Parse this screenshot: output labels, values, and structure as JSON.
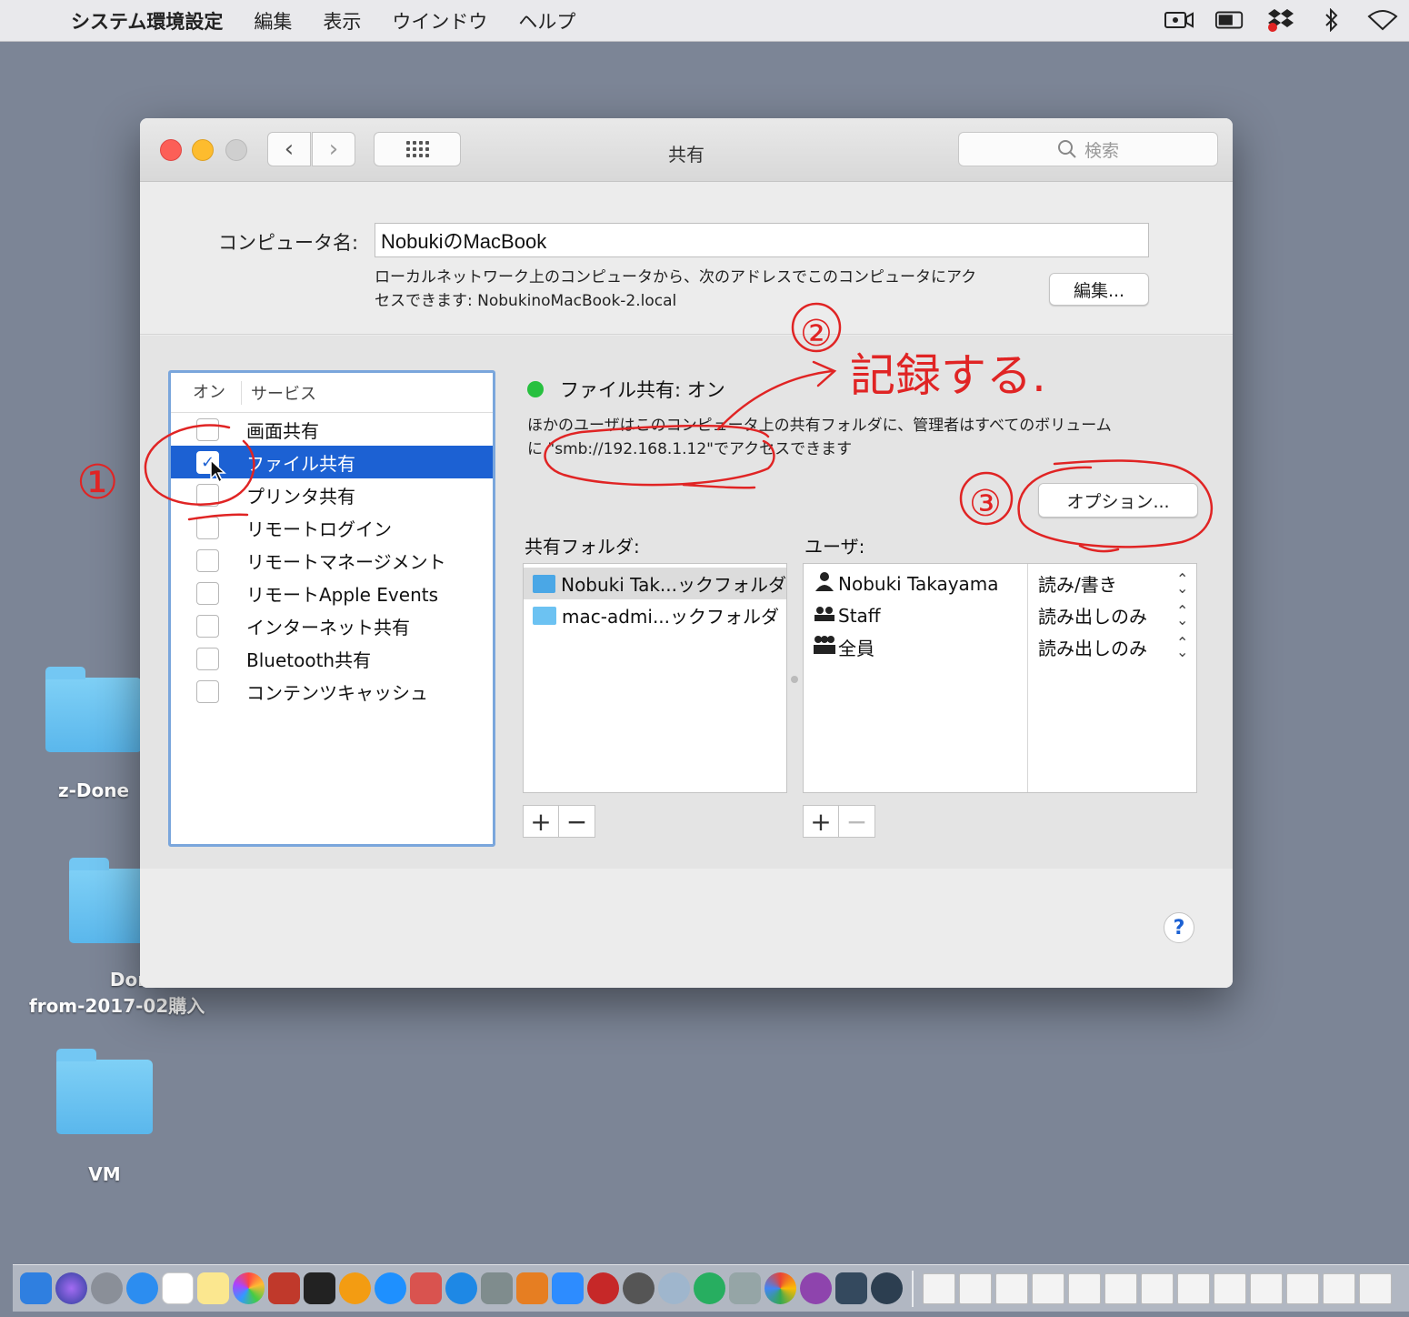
{
  "menubar": {
    "apple_icon": "apple-icon",
    "app_name": "システム環境設定",
    "menus": [
      "編集",
      "表示",
      "ウインドウ",
      "ヘルプ"
    ],
    "status_icons": [
      "screen-record-icon",
      "battery-icon",
      "dropbox-icon",
      "bluetooth-icon",
      "wifi-icon"
    ]
  },
  "desktop": {
    "items": [
      {
        "label": "z-Done"
      },
      {
        "label_line1": "Done",
        "label_line2": "from-2017-02購入"
      },
      {
        "label": "VM"
      }
    ]
  },
  "window": {
    "title": "共有",
    "search_placeholder": "検索",
    "computer_name_label": "コンピュータ名:",
    "computer_name_value": "NobukiのMacBook",
    "address_line1": "ローカルネットワーク上のコンピュータから、次のアドレスでこのコンピュータにアク",
    "address_line2": "セスできます: NobukinoMacBook-2.local",
    "edit_button": "編集...",
    "service_header_on": "オン",
    "service_header_service": "サービス",
    "services": [
      {
        "label": "画面共有",
        "checked": false
      },
      {
        "label": "ファイル共有",
        "checked": true
      },
      {
        "label": "プリンタ共有",
        "checked": false
      },
      {
        "label": "リモートログイン",
        "checked": false
      },
      {
        "label": "リモートマネージメント",
        "checked": false
      },
      {
        "label": "リモートApple Events",
        "checked": false
      },
      {
        "label": "インターネット共有",
        "checked": false
      },
      {
        "label": "Bluetooth共有",
        "checked": false
      },
      {
        "label": "コンテンツキャッシュ",
        "checked": false
      }
    ],
    "status_title": "ファイル共有: オン",
    "status_desc_line1": "ほかのユーザはこのコンピュータ上の共有フォルダに、管理者はすべてのボリューム",
    "status_desc_line2": "に \"smb://192.168.1.12\"でアクセスできます",
    "options_button": "オプション...",
    "shared_folders_label": "共有フォルダ:",
    "users_label": "ユーザ:",
    "shared_folders": [
      "Nobuki Tak...ックフォルダ",
      "mac-admi...ックフォルダ"
    ],
    "users": [
      {
        "name": "Nobuki Takayama",
        "permission": "読み/書き",
        "icon": "user-icon"
      },
      {
        "name": "Staff",
        "permission": "読み出しのみ",
        "icon": "group-icon"
      },
      {
        "name": "全員",
        "permission": "読み出しのみ",
        "icon": "everyone-icon"
      }
    ],
    "plus_label": "+",
    "minus_label": "−",
    "help_label": "?"
  },
  "annotations": {
    "note_1": "①",
    "note_2": "②",
    "note_2_text": "記録する.",
    "note_3": "③",
    "color": "#e02424"
  }
}
